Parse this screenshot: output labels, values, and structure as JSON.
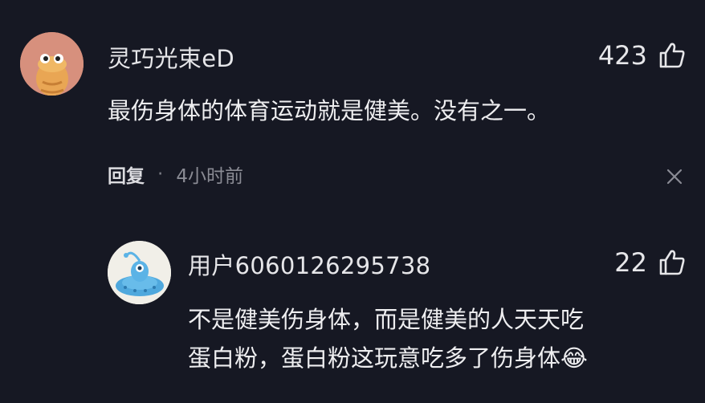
{
  "comments": [
    {
      "username": "灵巧光束eD",
      "likes": "423",
      "text": "最伤身体的体育运动就是健美。没有之一。",
      "reply_label": "回复",
      "separator": "·",
      "time": "4小时前"
    },
    {
      "username": "用户6060126295738",
      "likes": "22",
      "text_line1": "不是健美伤身体，而是健美的人天天吃",
      "text_line2": "蛋白粉，蛋白粉这玩意吃多了伤身体",
      "emoji": "😂"
    }
  ],
  "icons": {
    "like": "thumbs-up-icon",
    "close": "close-icon"
  },
  "colors": {
    "background": "#161823",
    "text": "#e6e6e9",
    "muted": "#8a8b94"
  }
}
